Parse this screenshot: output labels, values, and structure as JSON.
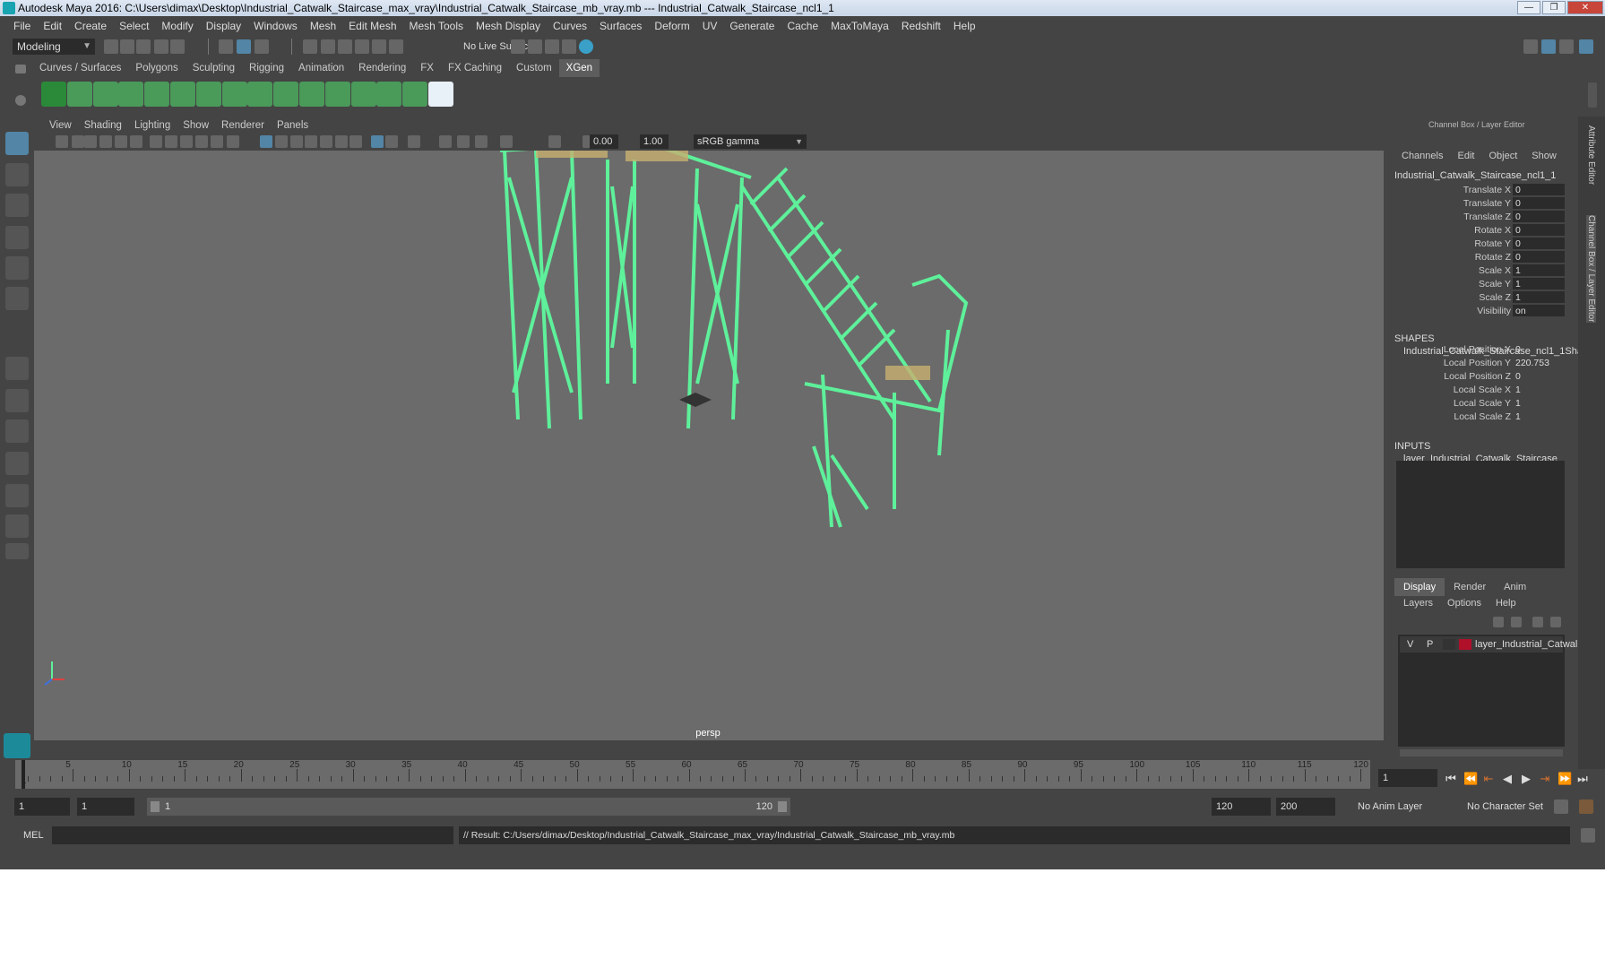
{
  "window": {
    "title": "Autodesk Maya 2016: C:\\Users\\dimax\\Desktop\\Industrial_Catwalk_Staircase_max_vray\\Industrial_Catwalk_Staircase_mb_vray.mb  ---  Industrial_Catwalk_Staircase_ncl1_1",
    "controls": [
      "—",
      "❐",
      "✕"
    ]
  },
  "menubar": [
    "File",
    "Edit",
    "Create",
    "Select",
    "Modify",
    "Display",
    "Windows",
    "Mesh",
    "Edit Mesh",
    "Mesh Tools",
    "Mesh Display",
    "Curves",
    "Surfaces",
    "Deform",
    "UV",
    "Generate",
    "Cache",
    "MaxToMaya",
    "Redshift",
    "Help"
  ],
  "toolbar": {
    "mode": "Modeling",
    "live_surface": "No Live Surface"
  },
  "shelf_tabs": [
    "Curves / Surfaces",
    "Polygons",
    "Sculpting",
    "Rigging",
    "Animation",
    "Rendering",
    "FX",
    "FX Caching",
    "Custom",
    "XGen"
  ],
  "shelf_active": "XGen",
  "panel": {
    "menu": [
      "View",
      "Shading",
      "Lighting",
      "Show",
      "Renderer",
      "Panels"
    ],
    "exposure": "0.00",
    "gamma": "1.00",
    "color_space": "sRGB gamma",
    "camera": "persp"
  },
  "channel_box": {
    "title": "Channel Box / Layer Editor",
    "menu": [
      "Channels",
      "Edit",
      "Object",
      "Show"
    ],
    "object_name": "Industrial_Catwalk_Staircase_ncl1_1",
    "transforms": [
      {
        "label": "Translate X",
        "value": "0"
      },
      {
        "label": "Translate Y",
        "value": "0"
      },
      {
        "label": "Translate Z",
        "value": "0"
      },
      {
        "label": "Rotate X",
        "value": "0"
      },
      {
        "label": "Rotate Y",
        "value": "0"
      },
      {
        "label": "Rotate Z",
        "value": "0"
      },
      {
        "label": "Scale X",
        "value": "1"
      },
      {
        "label": "Scale Y",
        "value": "1"
      },
      {
        "label": "Scale Z",
        "value": "1"
      },
      {
        "label": "Visibility",
        "value": "on"
      }
    ],
    "shapes_header": "SHAPES",
    "shape_name": "Industrial_Catwalk_Staircase_ncl1_1Sha...",
    "shape_attrs": [
      {
        "label": "Local Position X",
        "value": "0"
      },
      {
        "label": "Local Position Y",
        "value": "220.753"
      },
      {
        "label": "Local Position Z",
        "value": "0"
      },
      {
        "label": "Local Scale X",
        "value": "1"
      },
      {
        "label": "Local Scale Y",
        "value": "1"
      },
      {
        "label": "Local Scale Z",
        "value": "1"
      }
    ],
    "inputs_header": "INPUTS",
    "input_name": "layer_Industrial_Catwalk_Staircase"
  },
  "side_tabs": [
    "Attribute Editor",
    "Channel Box / Layer Editor"
  ],
  "layer_editor": {
    "tabs": [
      "Display",
      "Render",
      "Anim"
    ],
    "active_tab": "Display",
    "menu": [
      "Layers",
      "Options",
      "Help"
    ],
    "layer": {
      "v": "V",
      "p": "P",
      "name": "layer_Industrial_Catwalk",
      "color": "#b0102a"
    }
  },
  "timeline": {
    "ticks": [
      "5",
      "10",
      "15",
      "20",
      "25",
      "30",
      "35",
      "40",
      "45",
      "50",
      "55",
      "60",
      "65",
      "70",
      "75",
      "80",
      "85",
      "90",
      "95",
      "100",
      "105",
      "110",
      "115",
      "120"
    ],
    "current_frame_label": "1",
    "current_frame_field": "1"
  },
  "range": {
    "start": "1",
    "start2": "1",
    "slider_start": "1",
    "slider_end": "120",
    "end": "120",
    "end2": "200",
    "anim_layer": "No Anim Layer",
    "char_set": "No Character Set"
  },
  "command_line": {
    "label": "MEL",
    "result": "// Result: C:/Users/dimax/Desktop/Industrial_Catwalk_Staircase_max_vray/Industrial_Catwalk_Staircase_mb_vray.mb"
  },
  "colors": {
    "wireframe": "#5ef09a",
    "selected_tool": "#5285a6",
    "viewport_bg": "#6b6b6b",
    "accent_tan": "#c8b070"
  }
}
